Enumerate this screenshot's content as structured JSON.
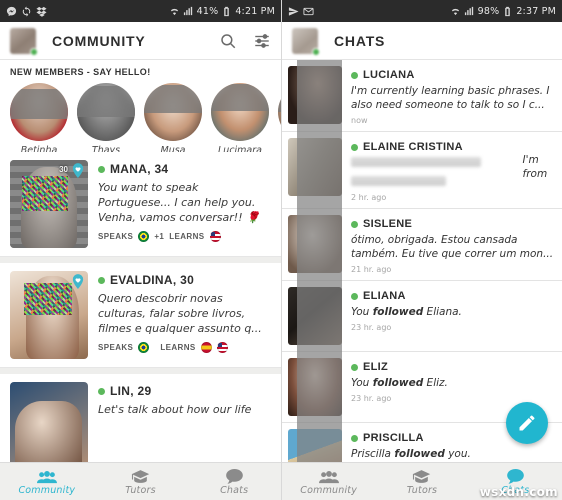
{
  "left": {
    "status_bar": {
      "left_icons": [
        "messenger-icon",
        "sync-icon",
        "dropbox-icon"
      ],
      "wifi": "wifi-icon",
      "signal": "signal-icon",
      "battery_pct": "41%",
      "time": "4:21 PM"
    },
    "appbar": {
      "title": "COMMUNITY",
      "search": "search-icon",
      "filter": "filter-icon"
    },
    "new_members": {
      "title": "NEW MEMBERS - SAY HELLO!",
      "people": [
        {
          "name": "Betinha"
        },
        {
          "name": "Thays"
        },
        {
          "name": "Musa"
        },
        {
          "name": "Lucimara"
        },
        {
          "name": ""
        }
      ]
    },
    "cards": [
      {
        "name": "MANA, 34",
        "text": "You want to speak Portuguese... I can help you. Venha, vamos conversar!! 🌹",
        "badge": "30",
        "speaks_label": "SPEAKS",
        "speaks_extra": "+1",
        "learns_label": "LEARNS",
        "speaks_flags": [
          "br"
        ],
        "learns_flags": [
          "us"
        ]
      },
      {
        "name": "EVALDINA, 30",
        "text": "Quero descobrir novas culturas, falar sobre livros, filmes e qualquer assunto q...",
        "badge": "",
        "speaks_label": "SPEAKS",
        "speaks_extra": "",
        "learns_label": "LEARNS",
        "speaks_flags": [
          "br"
        ],
        "learns_flags": [
          "es",
          "us"
        ]
      },
      {
        "name": "LIN, 29",
        "text": "Let's talk about how our life",
        "badge": "",
        "speaks_label": "",
        "speaks_extra": "",
        "learns_label": "",
        "speaks_flags": [],
        "learns_flags": []
      }
    ],
    "bottom_nav": [
      {
        "label": "Community",
        "icon": "people-icon",
        "active": true
      },
      {
        "label": "Tutors",
        "icon": "graduation-cap-icon",
        "active": false
      },
      {
        "label": "Chats",
        "icon": "chat-bubble-icon",
        "active": false
      }
    ]
  },
  "right": {
    "status_bar": {
      "left_icons": [
        "send-icon",
        "mail-icon"
      ],
      "wifi": "wifi-icon",
      "signal": "signal-icon",
      "battery_pct": "98%",
      "time": "2:37 PM"
    },
    "appbar": {
      "title": "CHATS"
    },
    "chats": [
      {
        "name": "LUCIANA",
        "message": "I'm currently learning basic phrases. I also need someone to talk to so I c...",
        "message_bold": "",
        "time": "now",
        "redacted": false
      },
      {
        "name": "ELAINE CRISTINA",
        "message": "I'm from",
        "message_bold": "",
        "time": "2 hr. ago",
        "redacted": true
      },
      {
        "name": "SISLENE",
        "message": "ótimo, obrigada. Estou cansada também. Eu tive que correr um mon...",
        "message_bold": "",
        "time": "21 hr. ago",
        "redacted": false
      },
      {
        "name": "ELIANA",
        "message_pre": "You ",
        "message_bold": "followed",
        "message_post": " Eliana.",
        "time": "23 hr. ago",
        "redacted": false
      },
      {
        "name": "ELIZ",
        "message_pre": "You ",
        "message_bold": "followed",
        "message_post": " Eliz.",
        "time": "23 hr. ago",
        "redacted": false
      },
      {
        "name": "PRISCILLA",
        "message_pre": "Priscilla ",
        "message_bold": "followed",
        "message_post": " you.",
        "time": "",
        "redacted": false
      }
    ],
    "fab": {
      "icon": "pencil-icon"
    },
    "bottom_nav": [
      {
        "label": "Community",
        "icon": "people-icon",
        "active": false
      },
      {
        "label": "Tutors",
        "icon": "graduation-cap-icon",
        "active": false
      },
      {
        "label": "Chats",
        "icon": "chat-bubble-icon",
        "active": true
      }
    ]
  },
  "watermark": "wsxdn.com",
  "colors": {
    "accent": "#21b6cf",
    "online": "#5cb85c",
    "statusbar": "#2b2b2b"
  }
}
